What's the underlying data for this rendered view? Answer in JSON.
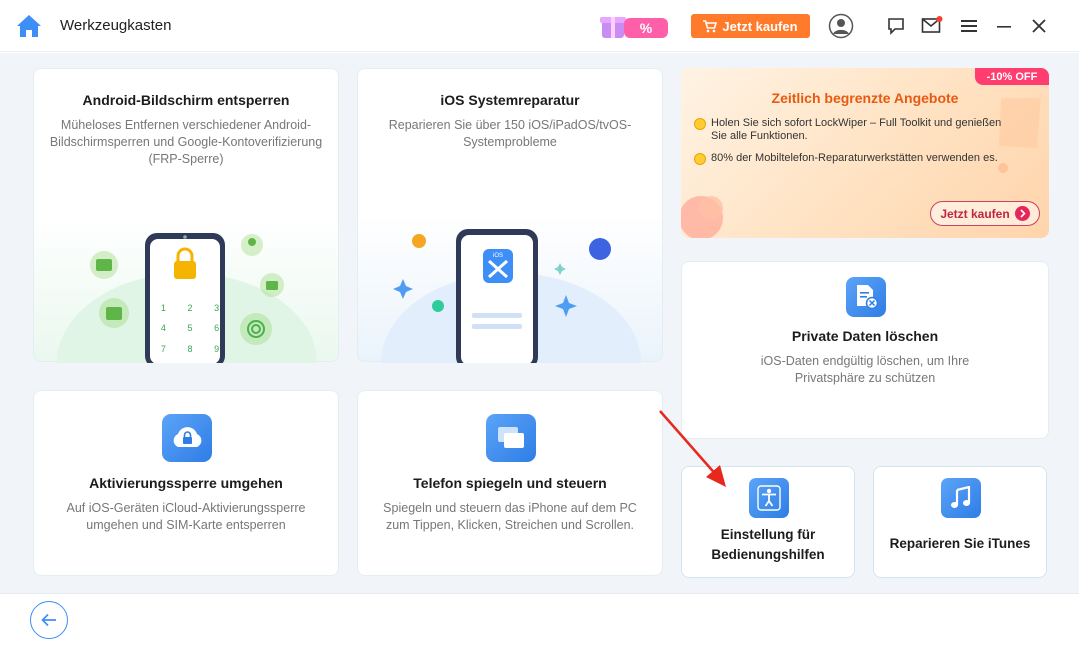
{
  "app": {
    "title": "Werkzeugkasten",
    "buy_label": "Jetzt kaufen",
    "promo_badge_text": "%"
  },
  "colors": {
    "accent_orange": "#ff7a2b",
    "brand_blue": "#3e8ef7",
    "offer_title": "#e65a12",
    "ribbon_pink": "#ff3d6f"
  },
  "cards": {
    "android": {
      "title": "Android-Bildschirm entsperren",
      "desc": "Müheloses Entfernen verschiedener Android-Bildschirmsperren und Google-Kontoverifizierung (FRP-Sperre)",
      "keypad": [
        "1",
        "2",
        "3",
        "4",
        "5",
        "6",
        "7",
        "8",
        "9"
      ]
    },
    "ios_repair": {
      "title": "iOS Systemreparatur",
      "desc": "Reparieren Sie über 150 iOS/iPadOS/tvOS-Systemprobleme",
      "badge": "iOS"
    },
    "activation": {
      "title": "Aktivierungssperre umgehen",
      "desc": "Auf iOS-Geräten iCloud-Aktivierungssperre umgehen und SIM-Karte entsperren"
    },
    "mirror": {
      "title": "Telefon spiegeln und steuern",
      "desc": "Spiegeln und steuern das iPhone auf dem PC zum Tippen, Klicken, Streichen und Scrollen."
    },
    "private": {
      "title": "Private Daten löschen",
      "desc": "iOS-Daten endgültig löschen, um Ihre Privatsphäre zu schützen"
    },
    "accessibility": {
      "title_line1": "Einstellung für",
      "title_line2": "Bedienungshilfen"
    },
    "itunes": {
      "title": "Reparieren Sie iTunes"
    }
  },
  "offer": {
    "ribbon": "-10% OFF",
    "title": "Zeitlich begrenzte Angebote",
    "items": [
      "Holen Sie sich sofort LockWiper – Full Toolkit und genießen Sie alle Funktionen.",
      "80% der Mobiltelefon-Reparaturwerkstätten verwenden es."
    ],
    "button": "Jetzt kaufen"
  }
}
